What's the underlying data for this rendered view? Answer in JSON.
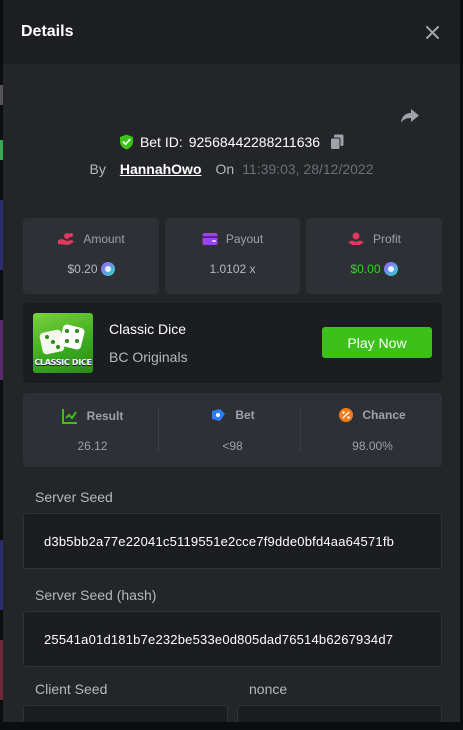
{
  "modal": {
    "title": "Details"
  },
  "bet": {
    "id_label": "Bet ID:",
    "id_value": "92568442288211636",
    "by_label": "By",
    "user": "HannahOwo",
    "on_label": "On",
    "timestamp": "11:39:03, 28/12/2022"
  },
  "stats": {
    "amount": {
      "label": "Amount",
      "value": "$0.20"
    },
    "payout": {
      "label": "Payout",
      "value": "1.0102 x"
    },
    "profit": {
      "label": "Profit",
      "value": "$0.00"
    }
  },
  "game": {
    "thumb_label": "CLASSIC DICE",
    "name": "Classic Dice",
    "provider": "BC Originals",
    "play_label": "Play Now"
  },
  "result": {
    "result": {
      "label": "Result",
      "value": "26.12"
    },
    "bet": {
      "label": "Bet",
      "value": "<98"
    },
    "chance": {
      "label": "Chance",
      "value": "98.00%"
    }
  },
  "seeds": {
    "server_seed_label": "Server Seed",
    "server_seed_value": "d3b5bb2a77e22041c5119551e2cce7f9dde0bfd4aa64571fb",
    "server_hash_label": "Server Seed (hash)",
    "server_hash_value": "25541a01d181b7e232be533e0d805dad76514b6267934d7",
    "client_seed_label": "Client Seed",
    "nonce_label": "nonce"
  },
  "colors": {
    "accent_green": "#3bc117",
    "profit_green": "#39d12a",
    "panel": "#232529",
    "card": "#2d3035"
  }
}
